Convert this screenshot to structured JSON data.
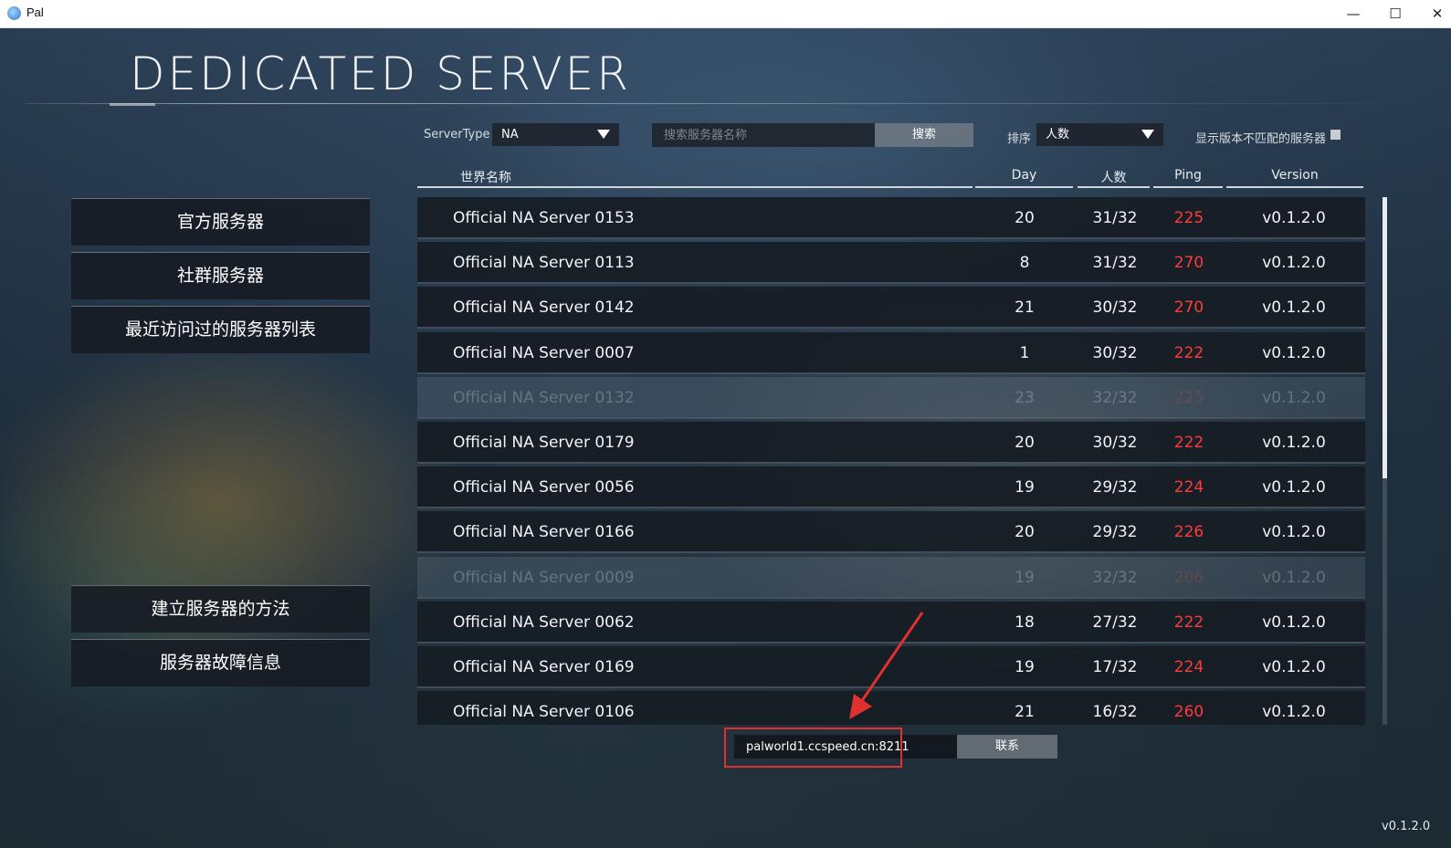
{
  "window": {
    "title": "Pal",
    "minimize": "—",
    "maximize": "☐",
    "close": "✕"
  },
  "page_title": "DEDICATED SERVER",
  "filters": {
    "server_type_label": "ServerType",
    "server_type_value": "NA",
    "search_placeholder": "搜索服务器名称",
    "search_button": "搜索",
    "sort_label": "排序",
    "sort_value": "人数",
    "mismatch_label": "显示版本不匹配的服务器",
    "mismatch_checked": false
  },
  "nav": {
    "official": "官方服务器",
    "community": "社群服务器",
    "recent": "最近访问过的服务器列表",
    "howto": "建立服务器的方法",
    "outage": "服务器故障信息"
  },
  "table": {
    "headers": {
      "name": "世界名称",
      "day": "Day",
      "players": "人数",
      "ping": "Ping",
      "version": "Version"
    },
    "rows": [
      {
        "name": "Official NA Server 0153",
        "day": "20",
        "players": "31/32",
        "ping": "225",
        "version": "v0.1.2.0",
        "dim": false
      },
      {
        "name": "Official NA Server 0113",
        "day": "8",
        "players": "31/32",
        "ping": "270",
        "version": "v0.1.2.0",
        "dim": false
      },
      {
        "name": "Official NA Server 0142",
        "day": "21",
        "players": "30/32",
        "ping": "270",
        "version": "v0.1.2.0",
        "dim": false
      },
      {
        "name": "Official NA Server 0007",
        "day": "1",
        "players": "30/32",
        "ping": "222",
        "version": "v0.1.2.0",
        "dim": false
      },
      {
        "name": "Official NA Server 0132",
        "day": "23",
        "players": "32/32",
        "ping": "225",
        "version": "v0.1.2.0",
        "dim": true
      },
      {
        "name": "Official NA Server 0179",
        "day": "20",
        "players": "30/32",
        "ping": "222",
        "version": "v0.1.2.0",
        "dim": false
      },
      {
        "name": "Official NA Server 0056",
        "day": "19",
        "players": "29/32",
        "ping": "224",
        "version": "v0.1.2.0",
        "dim": false
      },
      {
        "name": "Official NA Server 0166",
        "day": "20",
        "players": "29/32",
        "ping": "226",
        "version": "v0.1.2.0",
        "dim": false
      },
      {
        "name": "Official NA Server 0009",
        "day": "19",
        "players": "32/32",
        "ping": "206",
        "version": "v0.1.2.0",
        "dim": true
      },
      {
        "name": "Official NA Server 0062",
        "day": "18",
        "players": "27/32",
        "ping": "222",
        "version": "v0.1.2.0",
        "dim": false
      },
      {
        "name": "Official NA Server 0169",
        "day": "19",
        "players": "17/32",
        "ping": "224",
        "version": "v0.1.2.0",
        "dim": false
      },
      {
        "name": "Official NA Server 0106",
        "day": "21",
        "players": "16/32",
        "ping": "260",
        "version": "v0.1.2.0",
        "dim": false
      }
    ]
  },
  "connect": {
    "address_value": "palworld1.ccspeed.cn:8211",
    "button": "联系"
  },
  "version_label": "v0.1.2.0",
  "colors": {
    "ping": "#ff3b3b",
    "highlight": "#e03030"
  }
}
